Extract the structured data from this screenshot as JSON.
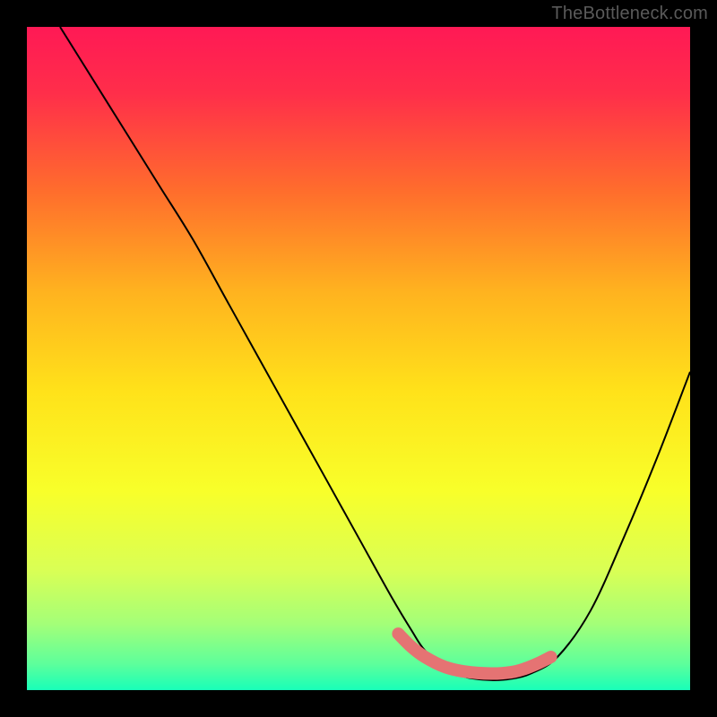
{
  "watermark": "TheBottleneck.com",
  "chart_data": {
    "type": "line",
    "title": "",
    "xlabel": "",
    "ylabel": "",
    "xlim": [
      0,
      100
    ],
    "ylim": [
      0,
      100
    ],
    "grid": false,
    "legend": false,
    "background_gradient": {
      "stops": [
        {
          "offset": 0.0,
          "color": "#ff1955"
        },
        {
          "offset": 0.1,
          "color": "#ff2e4a"
        },
        {
          "offset": 0.25,
          "color": "#ff6e2c"
        },
        {
          "offset": 0.4,
          "color": "#ffb31f"
        },
        {
          "offset": 0.55,
          "color": "#ffe21a"
        },
        {
          "offset": 0.7,
          "color": "#f8ff2a"
        },
        {
          "offset": 0.82,
          "color": "#d9ff55"
        },
        {
          "offset": 0.9,
          "color": "#a4ff78"
        },
        {
          "offset": 0.96,
          "color": "#5eff9b"
        },
        {
          "offset": 1.0,
          "color": "#18ffb8"
        }
      ]
    },
    "series": [
      {
        "name": "bottleneck-curve",
        "color": "#000000",
        "x": [
          5,
          10,
          15,
          20,
          25,
          30,
          35,
          40,
          45,
          50,
          55,
          58,
          60,
          63,
          66,
          70,
          73,
          76,
          80,
          85,
          90,
          95,
          100
        ],
        "y": [
          100,
          92,
          84,
          76,
          68,
          59,
          50,
          41,
          32,
          23,
          14,
          9,
          6,
          3.5,
          2,
          1.5,
          1.7,
          2.5,
          5,
          12,
          23,
          35,
          48
        ]
      },
      {
        "name": "highlight-region",
        "color": "#e57373",
        "style": "thick-rounded",
        "x": [
          56,
          58,
          60,
          63,
          66,
          70,
          73,
          75,
          77,
          79
        ],
        "y": [
          8.5,
          6.5,
          5,
          3.5,
          2.8,
          2.5,
          2.7,
          3.2,
          4,
          5
        ]
      }
    ]
  }
}
